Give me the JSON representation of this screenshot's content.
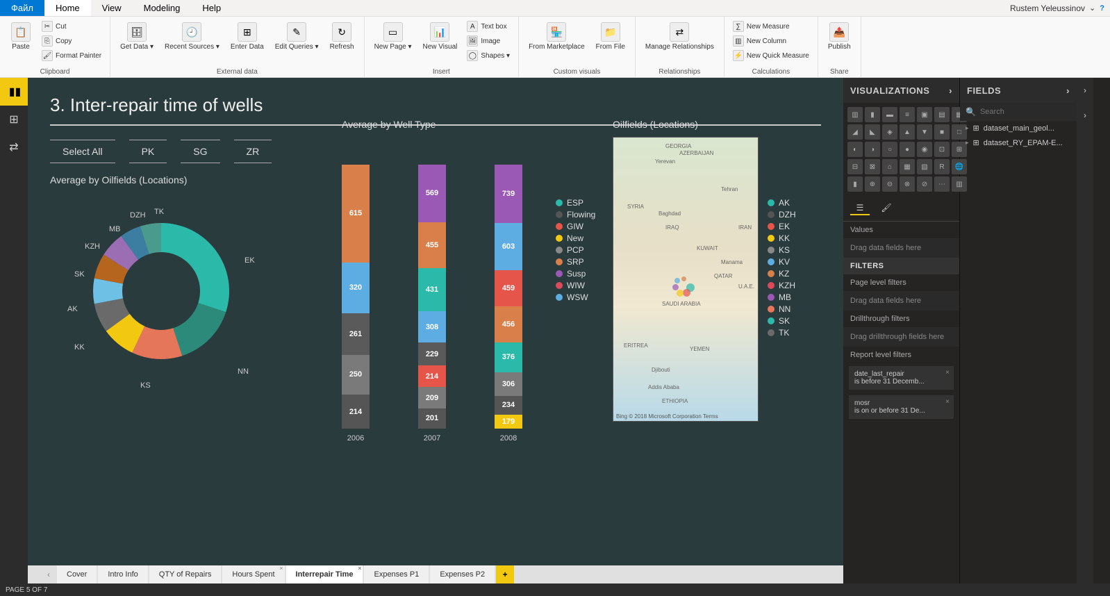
{
  "app": {
    "user": "Rustem Yeleussinov",
    "menu": {
      "file": "Файл",
      "home": "Home",
      "view": "View",
      "modeling": "Modeling",
      "help": "Help"
    }
  },
  "ribbon": {
    "clipboard": {
      "paste": "Paste",
      "cut": "Cut",
      "copy": "Copy",
      "format_painter": "Format Painter",
      "group": "Clipboard"
    },
    "external": {
      "get_data": "Get Data ▾",
      "recent": "Recent Sources ▾",
      "enter": "Enter Data",
      "edit": "Edit Queries ▾",
      "refresh": "Refresh",
      "group": "External data"
    },
    "insert": {
      "new_page": "New Page ▾",
      "new_visual": "New Visual",
      "text_box": "Text box",
      "image": "Image",
      "shapes": "Shapes ▾",
      "group": "Insert"
    },
    "custom": {
      "marketplace": "From Marketplace",
      "file": "From File",
      "group": "Custom visuals"
    },
    "relationships": {
      "manage": "Manage Relationships",
      "group": "Relationships"
    },
    "calculations": {
      "new_measure": "New Measure",
      "new_column": "New Column",
      "quick": "New Quick Measure",
      "group": "Calculations"
    },
    "share": {
      "publish": "Publish",
      "group": "Share"
    }
  },
  "report": {
    "title": "3. Inter-repair time of wells",
    "slicers": [
      "Select All",
      "PK",
      "SG",
      "ZR"
    ],
    "donut_title": "Average by Oilfields (Locations)",
    "ribbon_title": "Average by Well Type",
    "map_title": "Oilfields (Locations)"
  },
  "chart_data": [
    {
      "type": "pie",
      "title": "Average by Oilfields (Locations)",
      "series": [
        {
          "name": "EK",
          "value": 30,
          "color": "#2bb9a9"
        },
        {
          "name": "NN",
          "value": 15,
          "color": "#2b8a7a"
        },
        {
          "name": "KS",
          "value": 12,
          "color": "#e6765a"
        },
        {
          "name": "KK",
          "value": 8,
          "color": "#f2c811"
        },
        {
          "name": "AK",
          "value": 7,
          "color": "#6a6a6a"
        },
        {
          "name": "SK",
          "value": 6,
          "color": "#6ec1e4"
        },
        {
          "name": "KZH",
          "value": 6,
          "color": "#b5651d"
        },
        {
          "name": "MB",
          "value": 6,
          "color": "#9b6db3"
        },
        {
          "name": "DZH",
          "value": 5,
          "color": "#3b7ea1"
        },
        {
          "name": "TK",
          "value": 5,
          "color": "#4a9b8e"
        }
      ]
    },
    {
      "type": "area",
      "title": "Average by Well Type",
      "x": [
        "2006",
        "2007",
        "2008"
      ],
      "series": [
        {
          "name": "ESP",
          "color": "#2bb9a9",
          "values": [
            615,
            431,
            456
          ]
        },
        {
          "name": "Flowing",
          "color": "#3a3a3a",
          "values": [
            261,
            209,
            234
          ]
        },
        {
          "name": "GIW",
          "color": "#e6554a",
          "values": [
            214,
            214,
            459
          ]
        },
        {
          "name": "New",
          "color": "#f2c811",
          "values": [
            null,
            null,
            179
          ]
        },
        {
          "name": "PCP",
          "color": "#7a7a7a",
          "values": [
            250,
            201,
            306
          ]
        },
        {
          "name": "SRP",
          "color": "#d97f4a",
          "values": [
            320,
            455,
            376
          ]
        },
        {
          "name": "Susp",
          "color": "#9b59b6",
          "values": [
            null,
            569,
            739
          ]
        },
        {
          "name": "WIW",
          "color": "#d94a5a",
          "values": [
            null,
            229,
            null
          ]
        },
        {
          "name": "WSW",
          "color": "#5dade2",
          "values": [
            null,
            308,
            603
          ]
        }
      ]
    }
  ],
  "well_legend": [
    {
      "name": "ESP",
      "color": "#2bb9a9"
    },
    {
      "name": "Flowing",
      "color": "#555"
    },
    {
      "name": "GIW",
      "color": "#e6554a"
    },
    {
      "name": "New",
      "color": "#f2c811"
    },
    {
      "name": "PCP",
      "color": "#888"
    },
    {
      "name": "SRP",
      "color": "#d97f4a"
    },
    {
      "name": "Susp",
      "color": "#9b59b6"
    },
    {
      "name": "WIW",
      "color": "#d94a5a"
    },
    {
      "name": "WSW",
      "color": "#5dade2"
    }
  ],
  "map_legend": [
    {
      "name": "AK",
      "color": "#2bb9a9"
    },
    {
      "name": "DZH",
      "color": "#555"
    },
    {
      "name": "EK",
      "color": "#e6554a"
    },
    {
      "name": "KK",
      "color": "#f2c811"
    },
    {
      "name": "KS",
      "color": "#888"
    },
    {
      "name": "KV",
      "color": "#5dade2"
    },
    {
      "name": "KZ",
      "color": "#d97f4a"
    },
    {
      "name": "KZH",
      "color": "#d94a5a"
    },
    {
      "name": "MB",
      "color": "#9b59b6"
    },
    {
      "name": "NN",
      "color": "#e6765a"
    },
    {
      "name": "SK",
      "color": "#2bb9a9"
    },
    {
      "name": "TK",
      "color": "#6a6a6a"
    }
  ],
  "map_places": [
    "GEORGIA",
    "AZERBAIJAN",
    "Yerevan",
    "Tehran",
    "SYRIA",
    "Baghdad",
    "IRAQ",
    "IRAN",
    "KUWAIT",
    "Manama",
    "QATAR",
    "U.A.E.",
    "SAUDI ARABIA",
    "ERITREA",
    "YEMEN",
    "Djibouti",
    "Addis Ababa",
    "ETHIOPIA"
  ],
  "map_attr": "Bing    © 2018 Microsoft Corporation  Terms",
  "tabs": [
    {
      "name": "Cover",
      "active": false
    },
    {
      "name": "Intro Info",
      "active": false
    },
    {
      "name": "QTY of Repairs",
      "active": false
    },
    {
      "name": "Hours Spent",
      "active": false,
      "closable": true
    },
    {
      "name": "Interrepair Time",
      "active": true,
      "closable": true
    },
    {
      "name": "Expenses P1",
      "active": false
    },
    {
      "name": "Expenses P2",
      "active": false
    }
  ],
  "status": "PAGE 5 OF 7",
  "panels": {
    "viz_header": "VISUALIZATIONS",
    "fields_header": "FIELDS",
    "values_label": "Values",
    "drag_data": "Drag data fields here",
    "filters_header": "FILTERS",
    "page_filters": "Page level filters",
    "drill_filters": "Drillthrough filters",
    "drag_drill": "Drag drillthrough fields here",
    "report_filters": "Report level filters",
    "filter1_name": "date_last_repair",
    "filter1_cond": "is before 31 Decemb...",
    "filter2_name": "mosr",
    "filter2_cond": "is on or before 31 De...",
    "search_placeholder": "Search",
    "datasets": [
      "dataset_main_geol...",
      "dataset_RY_EPAM-E..."
    ]
  }
}
